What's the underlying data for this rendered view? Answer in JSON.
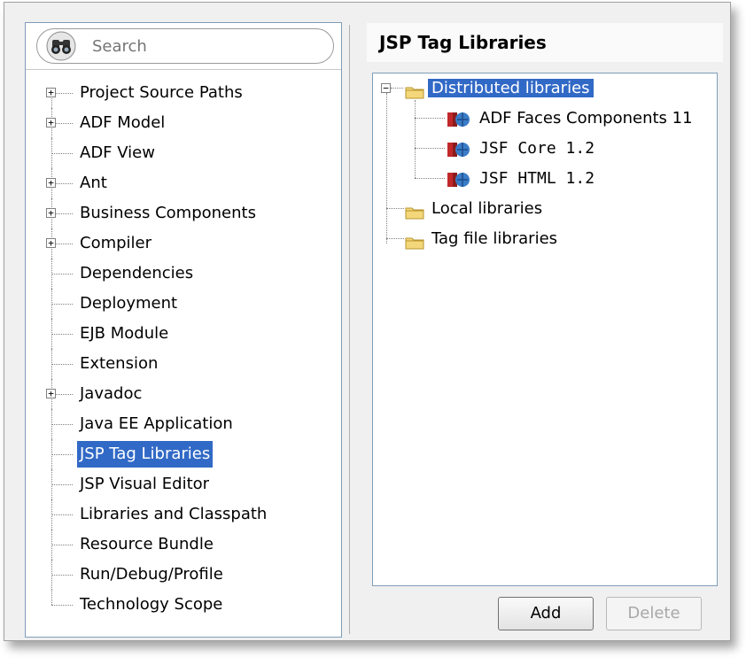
{
  "search": {
    "placeholder": "Search"
  },
  "left_tree": {
    "items": [
      {
        "label": "Project Source Paths",
        "expandable": true
      },
      {
        "label": "ADF Model",
        "expandable": true
      },
      {
        "label": "ADF View",
        "expandable": false
      },
      {
        "label": "Ant",
        "expandable": true
      },
      {
        "label": "Business Components",
        "expandable": true
      },
      {
        "label": "Compiler",
        "expandable": true
      },
      {
        "label": "Dependencies",
        "expandable": false
      },
      {
        "label": "Deployment",
        "expandable": false
      },
      {
        "label": "EJB Module",
        "expandable": false
      },
      {
        "label": "Extension",
        "expandable": false
      },
      {
        "label": "Javadoc",
        "expandable": true
      },
      {
        "label": "Java EE Application",
        "expandable": false
      },
      {
        "label": "JSP Tag Libraries",
        "expandable": false,
        "selected": true
      },
      {
        "label": "JSP Visual Editor",
        "expandable": false
      },
      {
        "label": "Libraries and Classpath",
        "expandable": false
      },
      {
        "label": "Resource Bundle",
        "expandable": false
      },
      {
        "label": "Run/Debug/Profile",
        "expandable": false
      },
      {
        "label": "Technology Scope",
        "expandable": false
      }
    ]
  },
  "right_panel": {
    "title": "JSP Tag Libraries",
    "tree": {
      "distributed": "Distributed libraries",
      "children": [
        "ADF Faces Components 11",
        "JSF Core 1.2",
        "JSF HTML 1.2"
      ],
      "local": "Local libraries",
      "tagfile": "Tag file libraries"
    }
  },
  "buttons": {
    "add": "Add",
    "delete": "Delete"
  },
  "colors": {
    "selection": "#3169c6",
    "folder": "#f3d77a",
    "border": "#7f9db9"
  }
}
